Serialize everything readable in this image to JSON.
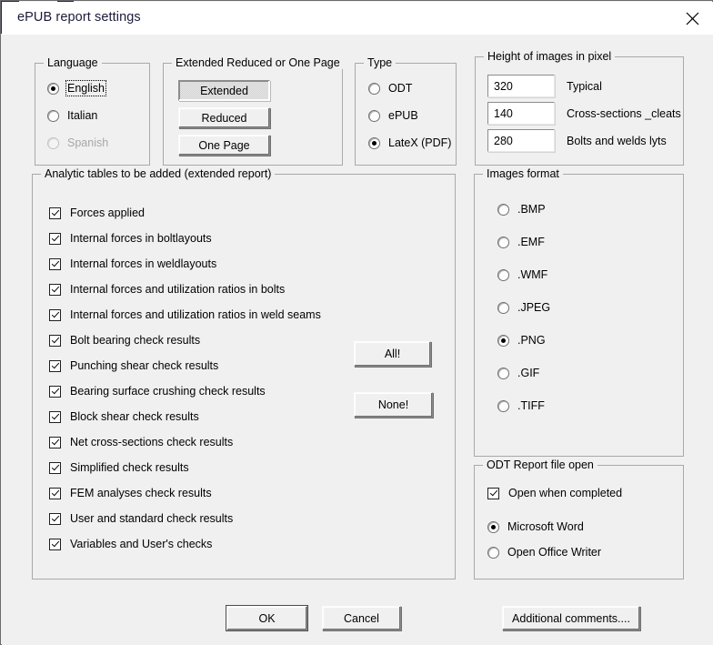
{
  "window": {
    "title": "ePUB report settings",
    "close_icon": "close-icon"
  },
  "language_group": {
    "legend": "Language",
    "options": [
      {
        "label": "English",
        "selected": true,
        "disabled": false,
        "focused": true
      },
      {
        "label": "Italian",
        "selected": false,
        "disabled": false,
        "focused": false
      },
      {
        "label": "Spanish",
        "selected": false,
        "disabled": true,
        "focused": false
      }
    ]
  },
  "extent_group": {
    "legend": "Extended Reduced or One Page",
    "buttons": [
      {
        "label": "Extended",
        "active": true
      },
      {
        "label": "Reduced",
        "active": false
      },
      {
        "label": "One Page",
        "active": false
      }
    ]
  },
  "type_group": {
    "legend": "Type",
    "options": [
      {
        "label": "ODT",
        "selected": false
      },
      {
        "label": "ePUB",
        "selected": false
      },
      {
        "label": "LateX (PDF)",
        "selected": true
      }
    ]
  },
  "height_group": {
    "legend": "Height of images in pixel",
    "fields": [
      {
        "value": "320",
        "label": "Typical"
      },
      {
        "value": "140",
        "label": "Cross-sections _cleats"
      },
      {
        "value": "280",
        "label": "Bolts and welds lyts"
      }
    ]
  },
  "tables_group": {
    "legend": "Analytic tables to be added (extended report)",
    "items": [
      {
        "label": "Forces applied",
        "checked": true
      },
      {
        "label": "Internal forces in boltlayouts",
        "checked": true
      },
      {
        "label": "Internal forces in weldlayouts",
        "checked": true
      },
      {
        "label": "Internal forces and utilization ratios in bolts",
        "checked": true
      },
      {
        "label": "Internal forces and utilization ratios in weld seams",
        "checked": true
      },
      {
        "label": "Bolt bearing check results",
        "checked": true
      },
      {
        "label": "Punching shear check results",
        "checked": true
      },
      {
        "label": "Bearing surface crushing check results",
        "checked": true
      },
      {
        "label": "Block shear check results",
        "checked": true
      },
      {
        "label": "Net cross-sections check results",
        "checked": true
      },
      {
        "label": "Simplified check results",
        "checked": true
      },
      {
        "label": "FEM analyses check results",
        "checked": true
      },
      {
        "label": "User and standard check results",
        "checked": true
      },
      {
        "label": "Variables and User's checks",
        "checked": true
      }
    ],
    "all_button": "All!",
    "none_button": "None!"
  },
  "images_format_group": {
    "legend": "Images format",
    "options": [
      {
        "label": ".BMP",
        "selected": false
      },
      {
        "label": ".EMF",
        "selected": false
      },
      {
        "label": ".WMF",
        "selected": false
      },
      {
        "label": ".JPEG",
        "selected": false
      },
      {
        "label": ".PNG",
        "selected": true
      },
      {
        "label": ".GIF",
        "selected": false
      },
      {
        "label": ".TIFF",
        "selected": false
      }
    ]
  },
  "odt_group": {
    "legend": "ODT Report file open",
    "checkbox": {
      "label": "Open when completed",
      "checked": true
    },
    "options": [
      {
        "label": "Microsoft Word",
        "selected": true
      },
      {
        "label": "Open Office Writer",
        "selected": false
      }
    ]
  },
  "footer": {
    "ok": "OK",
    "cancel": "Cancel",
    "additional": "Additional comments...."
  },
  "colors": {
    "window_bg": "#f0f0f0",
    "titlebar_bg": "#ffffff",
    "title_text": "#1b1b3a",
    "group_border": "#a9a9a9",
    "frame_accent": "#252160"
  }
}
